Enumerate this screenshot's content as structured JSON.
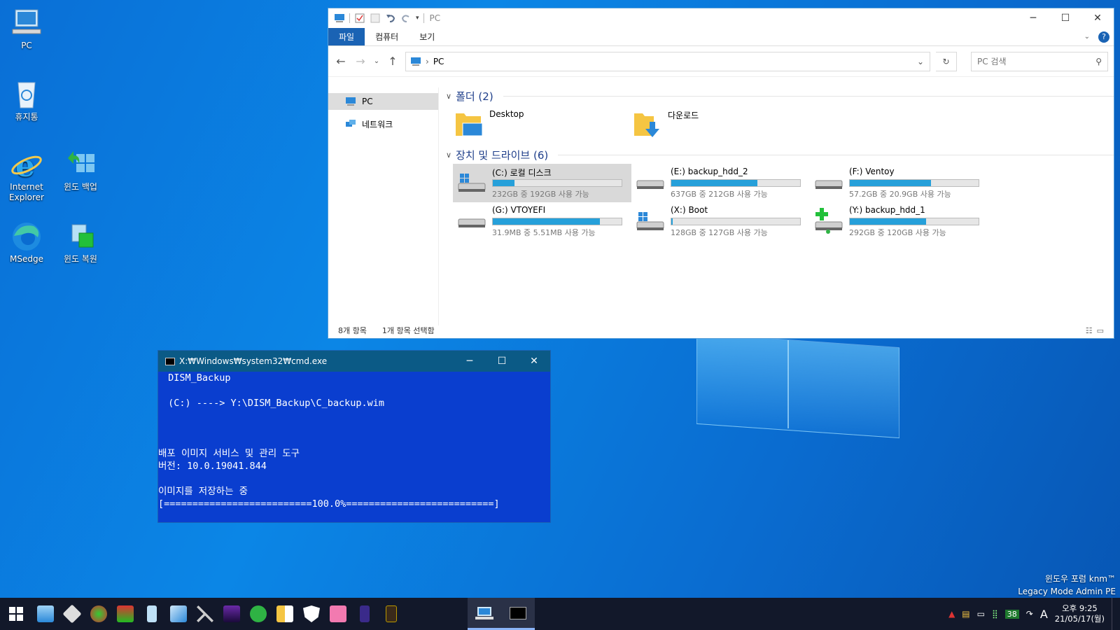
{
  "desktop": {
    "icons": [
      {
        "label": "PC"
      },
      {
        "label": "휴지통"
      },
      {
        "label": "Internet\nExplorer"
      },
      {
        "label": "윈도 백업"
      },
      {
        "label": "MSedge"
      },
      {
        "label": "윈도 복원"
      }
    ],
    "watermark_line1": "윈도우 포럼 knm™",
    "watermark_line2": "Legacy Mode Admin PE"
  },
  "explorer": {
    "title": "PC",
    "ribbon_tabs": [
      "파일",
      "컴퓨터",
      "보기"
    ],
    "address_label": "PC",
    "search_placeholder": "PC 검색",
    "nav_items": [
      "PC",
      "네트워크"
    ],
    "folders_header": "폴더 (2)",
    "folders": [
      "Desktop",
      "다운로드"
    ],
    "drives_header": "장치 및 드라이브 (6)",
    "drives": [
      {
        "name": "(C:) 로컬 디스크",
        "usage": "232GB 중 192GB 사용 가능",
        "used_fraction": 0.17,
        "selected": true,
        "icon": "windows-drive-icon"
      },
      {
        "name": "(E:) backup_hdd_2",
        "usage": "637GB 중 212GB 사용 가능",
        "used_fraction": 0.67,
        "icon": "hdd-icon"
      },
      {
        "name": "(F:) Ventoy",
        "usage": "57.2GB 중 20.9GB 사용 가능",
        "used_fraction": 0.63,
        "icon": "hdd-icon"
      },
      {
        "name": "(G:) VTOYEFI",
        "usage": "31.9MB 중 5.51MB 사용 가능",
        "used_fraction": 0.83,
        "icon": "hdd-icon"
      },
      {
        "name": "(X:) Boot",
        "usage": "128GB 중 127GB 사용 가능",
        "used_fraction": 0.01,
        "icon": "windows-drive-icon"
      },
      {
        "name": "(Y:) backup_hdd_1",
        "usage": "292GB 중 120GB 사용 가능",
        "used_fraction": 0.59,
        "icon": "network-drive-icon"
      }
    ],
    "status_count": "8개 항목",
    "status_selected": "1개 항목 선택함"
  },
  "cmd": {
    "title": "X:₩Windows₩system32₩cmd.exe",
    "lines": [
      " DISM_Backup",
      "",
      " (C:) ----> Y:\\DISM_Backup\\C_backup.wim",
      "",
      "",
      "",
      "배포 이미지 서비스 및 관리 도구",
      "버전: 10.0.19041.844",
      "",
      "이미지를 저장하는 중",
      "[==========================100.0%==========================]"
    ]
  },
  "taskbar": {
    "clock_time": "오후 9:25",
    "clock_date": "21/05/17(월)",
    "tray_badge": "38",
    "ime": "A",
    "colors": {
      "accent": "#26a0da",
      "taskbar": "#12182a",
      "cmd_bg": "#0a3ecf"
    }
  }
}
